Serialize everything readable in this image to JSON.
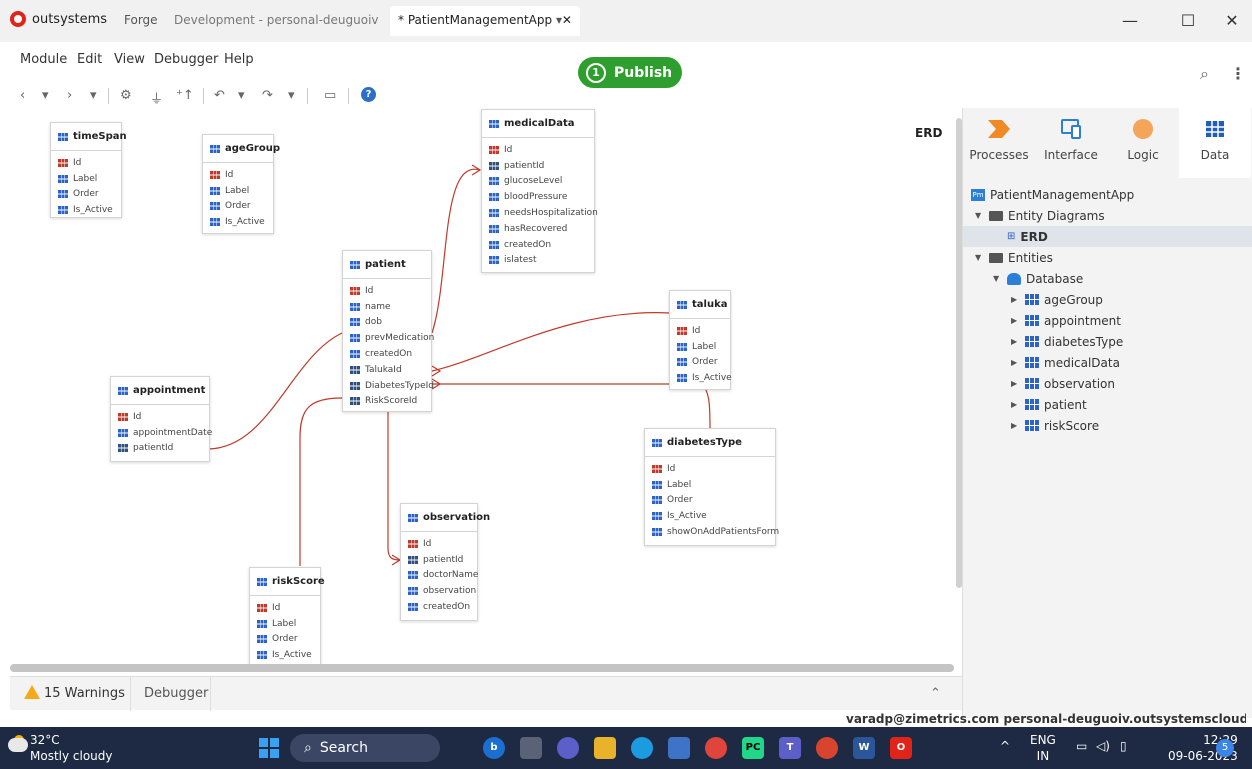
{
  "titlebar": {
    "brand": "outsystems",
    "tabs": [
      "Forge",
      "Development - personal-deuguoiv.outs",
      "* PatientManagementApp",
      "▾"
    ],
    "close_tab": "✕",
    "win_minimize": "—",
    "win_maximize": "☐",
    "win_close": "✕"
  },
  "menu": {
    "items": [
      "Module",
      "Edit",
      "View",
      "Debugger",
      "Help"
    ],
    "publish_number": "1",
    "publish_label": "Publish"
  },
  "toolbar": {
    "back": "‹",
    "forward": "›",
    "dropdown": "▾",
    "settings": "⚙",
    "plug": "⏚",
    "sort": "⁺↑",
    "undo": "↶",
    "redo": "↷",
    "comment": "▭",
    "help": "?",
    "search": "⌕",
    "grid": "⋮⋮"
  },
  "canvas": {
    "title": "ERD",
    "entities": {
      "timeSpan": {
        "name": "timeSpan",
        "attrs": [
          "Id",
          "Label",
          "Order",
          "Is_Active"
        ]
      },
      "ageGroup": {
        "name": "ageGroup",
        "attrs": [
          "Id",
          "Label",
          "Order",
          "Is_Active"
        ]
      },
      "medicalData": {
        "name": "medicalData",
        "attrs": [
          "Id",
          "patientId",
          "glucoseLevel",
          "bloodPressure",
          "needsHospitalization",
          "hasRecovered",
          "createdOn",
          "islatest"
        ]
      },
      "patient": {
        "name": "patient",
        "attrs": [
          "Id",
          "name",
          "dob",
          "prevMedication",
          "createdOn",
          "TalukaId",
          "DiabetesTypeId",
          "RiskScoreId"
        ]
      },
      "taluka": {
        "name": "taluka",
        "attrs": [
          "Id",
          "Label",
          "Order",
          "Is_Active"
        ]
      },
      "appointment": {
        "name": "appointment",
        "attrs": [
          "Id",
          "appointmentDate",
          "patientId"
        ]
      },
      "diabetesType": {
        "name": "diabetesType",
        "attrs": [
          "Id",
          "Label",
          "Order",
          "Is_Active",
          "showOnAddPatientsForm"
        ]
      },
      "observation": {
        "name": "observation",
        "attrs": [
          "Id",
          "patientId",
          "doctorName",
          "observation",
          "createdOn"
        ]
      },
      "riskScore": {
        "name": "riskScore",
        "attrs": [
          "Id",
          "Label",
          "Order",
          "Is_Active"
        ]
      }
    }
  },
  "right_panel": {
    "tabs": [
      "Processes",
      "Interface",
      "Logic",
      "Data"
    ],
    "tree": {
      "app": "PatientManagementApp",
      "entity_diagrams": "Entity Diagrams",
      "erd": "ERD",
      "entities": "Entities",
      "database": "Database",
      "items": [
        "ageGroup",
        "appointment",
        "diabetesType",
        "medicalData",
        "observation",
        "patient",
        "riskScore"
      ]
    }
  },
  "bottom": {
    "warnings": "15 Warnings",
    "debugger": "Debugger",
    "collapse": "⌃",
    "status": "varadp@zimetrics.com   personal-deuguoiv.outsystemscloud.com"
  },
  "taskbar": {
    "temp": "32°C",
    "weather": "Mostly cloudy",
    "search": "Search",
    "lang_top": "ENG",
    "lang_bottom": "IN",
    "time": "12:29",
    "date": "09-06-2023",
    "notifications": "5",
    "chevron": "^"
  },
  "colors": {
    "publish": "#2e9f2e",
    "relation_line": "#c0392b",
    "brand": "#e2231a",
    "taskbar": "#1e2a44"
  }
}
